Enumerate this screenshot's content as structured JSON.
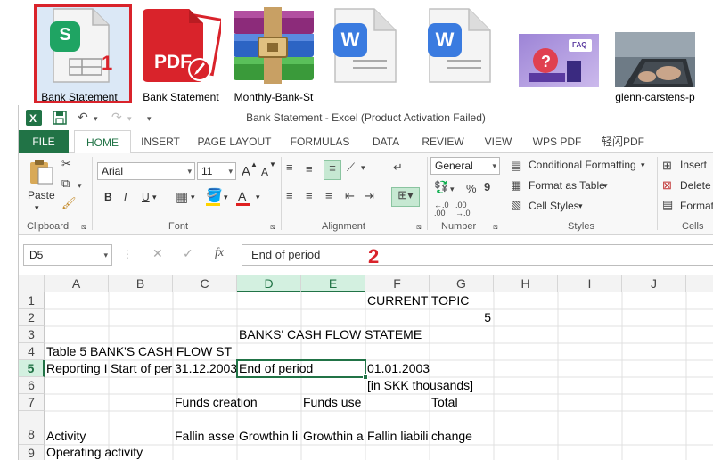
{
  "desktop": {
    "files": [
      {
        "label": "Bank Statement",
        "icon": "spreadsheet-file-icon",
        "selected": true
      },
      {
        "label": "Bank Statement",
        "icon": "pdf-file-icon"
      },
      {
        "label": "Monthly-Bank-St",
        "icon": "winrar-archive-icon"
      },
      {
        "label": "",
        "icon": "word-file-icon"
      },
      {
        "label": "",
        "icon": "word-file-icon"
      },
      {
        "label": "",
        "icon": "image-thumbnail-icon"
      },
      {
        "label": "glenn-carstens-p",
        "icon": "photo-thumbnail-icon"
      }
    ],
    "pdf_badge": "PDF",
    "spreadsheet_badge": "S",
    "word_badge": "W",
    "faq_badge": "FAQ",
    "annotation_1": "1",
    "annotation_2": "2"
  },
  "window": {
    "title": "Bank Statement - Excel (Product Activation Failed)",
    "app_icon": "X"
  },
  "ribbon_tabs": [
    "FILE",
    "HOME",
    "INSERT",
    "PAGE LAYOUT",
    "FORMULAS",
    "DATA",
    "REVIEW",
    "VIEW",
    "WPS PDF",
    "轻闪PDF"
  ],
  "ribbon": {
    "paste": "Paste",
    "font_name": "Arial",
    "font_size": "11",
    "bold": "B",
    "italic": "I",
    "underline": "U",
    "number_format": "General",
    "percent": "%",
    "comma": "9",
    "conditional_formatting": "Conditional Formatting",
    "format_as_table": "Format as Table",
    "cell_styles": "Cell Styles",
    "insert": "Insert",
    "delete": "Delete",
    "format": "Format",
    "groups": {
      "clipboard": "Clipboard",
      "font": "Font",
      "alignment": "Alignment",
      "number": "Number",
      "styles": "Styles",
      "cells": "Cells"
    },
    "grow_font": "A",
    "shrink_font": "A",
    "font_color": "A",
    "inc_decimal": "←.0\n.00",
    "dec_decimal": ".00\n→.0"
  },
  "formula_bar": {
    "name_box": "D5",
    "formula": "End of period",
    "fx": "fx"
  },
  "columns": [
    "A",
    "B",
    "C",
    "D",
    "E",
    "F",
    "G",
    "H",
    "I",
    "J"
  ],
  "rows": [
    "1",
    "2",
    "3",
    "4",
    "5",
    "6",
    "7",
    "8",
    "9"
  ],
  "cells": {
    "r1_f": "CURRENT TOPIC",
    "r2_g": "5",
    "r3_d": "BANKS' CASH FLOW STATEME",
    "r4_a": "Table 5 BANK'S CASH FLOW ST",
    "r5_a": "Reporting I",
    "r5_b": "Start of per",
    "r5_c": "31.12.2003",
    "r5_d": "End of period",
    "r5_f": "01.01.2003",
    "r6_f": "[in SKK thousands]",
    "r7_c": "Funds creation",
    "r7_e": "Funds use",
    "r7_g": "Total",
    "r8_a": "Activity",
    "r8_c": "Fallin asse",
    "r8_d": "Growthin li",
    "r8_e": "Growthin a",
    "r8_f": "Fallin liabili",
    "r8_g": "change",
    "r9_a": "Operating activity"
  },
  "colors": {
    "excel_green": "#217346",
    "annotation_red": "#d9232b"
  }
}
